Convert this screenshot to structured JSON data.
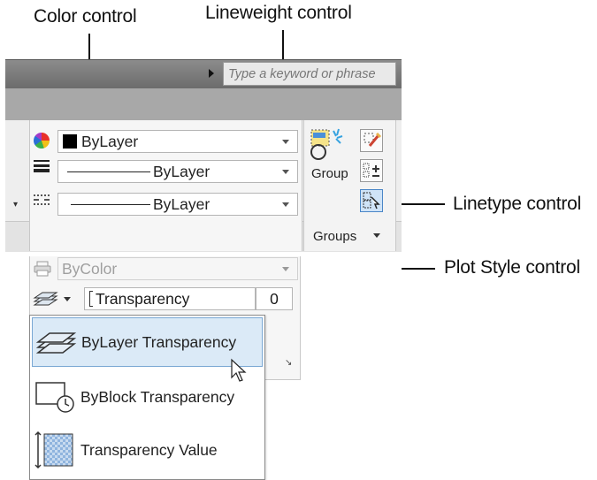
{
  "callouts": {
    "color_control": "Color control",
    "lineweight_control": "Lineweight control",
    "linetype_control": "Linetype control",
    "plot_style_control": "Plot Style control"
  },
  "search": {
    "placeholder": "Type a keyword or phrase"
  },
  "properties": {
    "color_value": "ByLayer",
    "lineweight_value": "ByLayer",
    "linetype_value": "ByLayer",
    "plot_style_value": "ByColor",
    "transparency_label": "Transparency",
    "transparency_value": "0"
  },
  "groups": {
    "group_label": "Group",
    "panel_title": "Groups"
  },
  "transparency_menu": {
    "items": [
      {
        "label": "ByLayer Transparency",
        "icon": "stacked-layers-icon"
      },
      {
        "label": "ByBlock Transparency",
        "icon": "block-icon"
      },
      {
        "label": "Transparency Value",
        "icon": "transparency-value-icon"
      }
    ]
  },
  "colors": {
    "title_bar": "#7a7a7a",
    "tab_row": "#a8a8a8",
    "highlight": "#dbeaf7",
    "highlight_border": "#7aa8d4"
  }
}
